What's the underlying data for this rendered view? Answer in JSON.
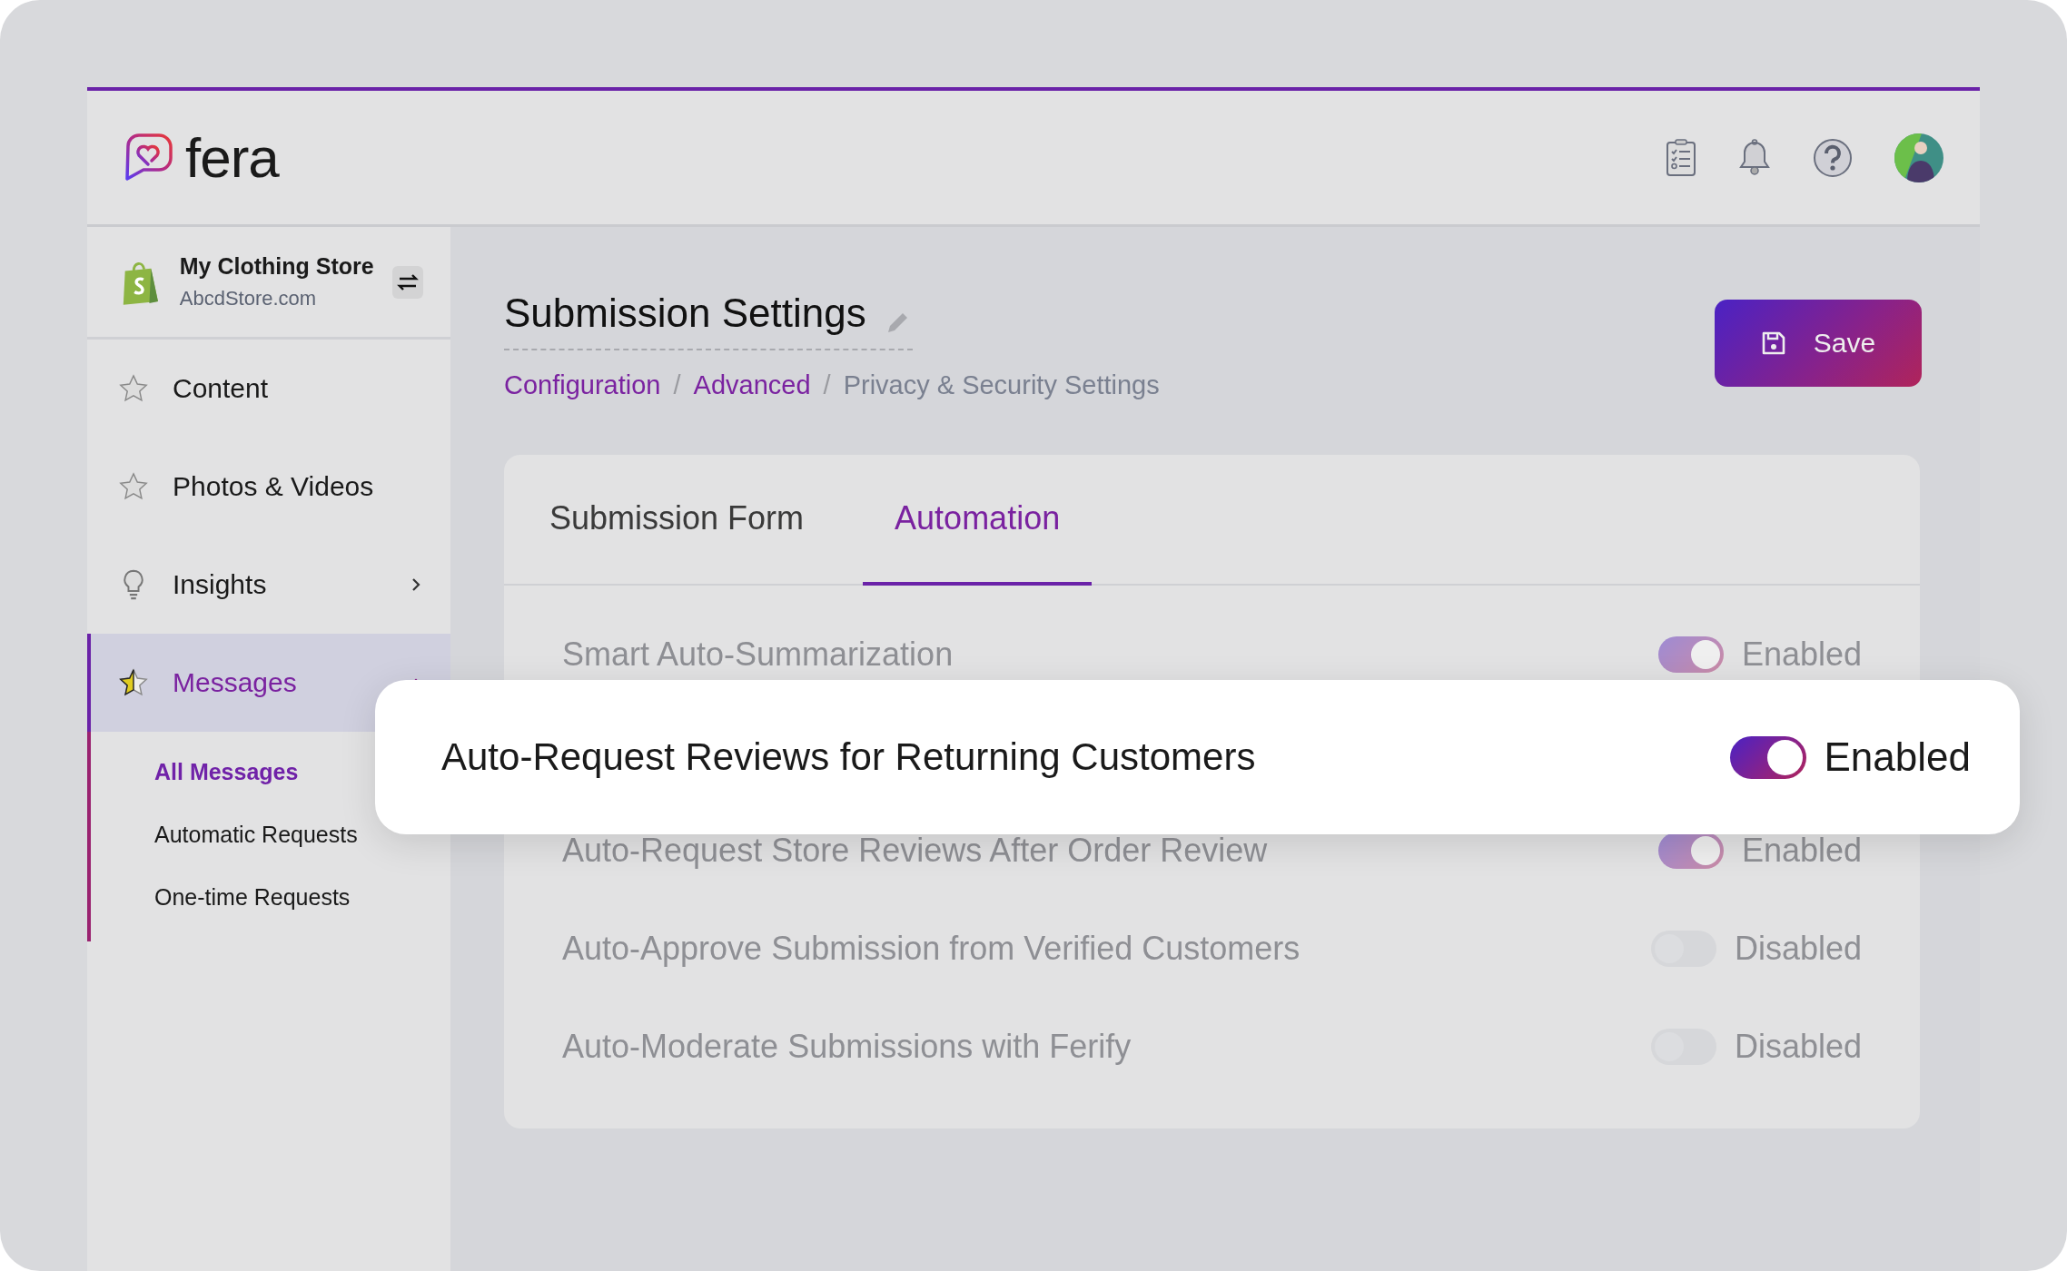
{
  "header": {
    "logo": "fera"
  },
  "store": {
    "name": "My Clothing Store",
    "domain": "AbcdStore.com"
  },
  "sidebar": {
    "items": [
      {
        "label": "Content",
        "selected": false
      },
      {
        "label": "Photos & Videos",
        "selected": false
      },
      {
        "label": "Insights",
        "selected": false,
        "expanded": false
      },
      {
        "label": "Messages",
        "selected": true,
        "expanded": true,
        "children": [
          {
            "label": "All Messages",
            "selected": true
          },
          {
            "label": "Automatic Requests",
            "selected": false
          },
          {
            "label": "One-time Requests",
            "selected": false
          }
        ]
      }
    ]
  },
  "page": {
    "title": "Submission Settings",
    "breadcrumb": [
      "Configuration",
      "Advanced",
      "Privacy & Security Settings"
    ],
    "breadcrumb_separator": "/",
    "save_button": "Save"
  },
  "tabs": [
    {
      "label": "Submission Form",
      "selected": false
    },
    {
      "label": "Automation",
      "selected": true
    }
  ],
  "rows": [
    {
      "kind": "row",
      "label": "Smart Auto-Summarization",
      "on": true,
      "status": "Enabled"
    },
    {
      "kind": "highlighted",
      "label": "Auto-Request Reviews for Returning Customers",
      "on": true,
      "status": "Enabled"
    },
    {
      "kind": "row",
      "label": "Auto-Request Store Reviews After Order Review",
      "on": true,
      "status": "Enabled"
    },
    {
      "kind": "row",
      "label": "Auto-Approve Submission from Verified Customers",
      "on": false,
      "status": "Disabled"
    },
    {
      "kind": "row",
      "label": "Auto-Moderate Submissions with Ferify",
      "on": false,
      "status": "Disabled"
    }
  ]
}
